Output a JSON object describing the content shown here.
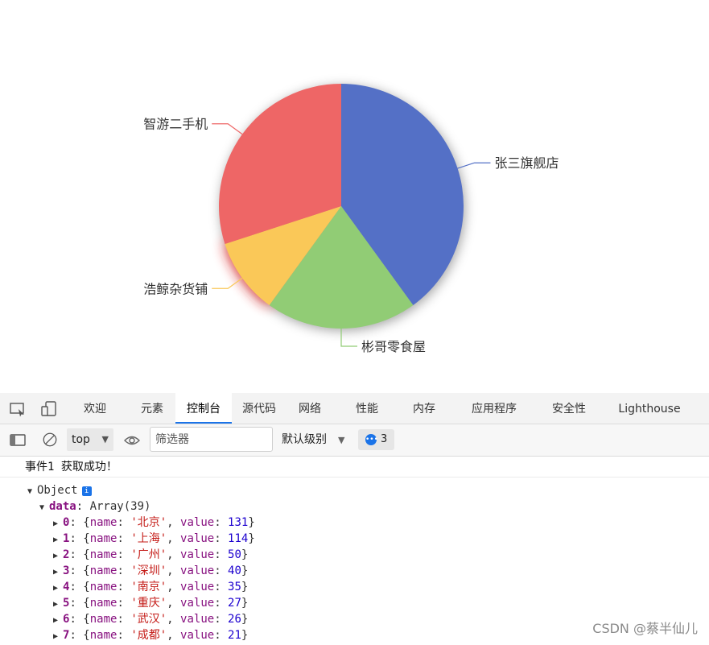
{
  "chart_data": {
    "type": "pie",
    "title": "",
    "slices": [
      {
        "name": "张三旗舰店",
        "value": 40,
        "color": "#5470c6"
      },
      {
        "name": "彬哥零食屋",
        "value": 20,
        "color": "#91cc75"
      },
      {
        "name": "浩鲸杂货铺",
        "value": 10,
        "color": "#fac858"
      },
      {
        "name": "智游二手机",
        "value": 30,
        "color": "#ee6666"
      }
    ],
    "start_angle_deg": 90,
    "direction": "clockwise",
    "labels": "outside-with-leader-lines",
    "emphasis_glow_color": "#ff2020",
    "legend": "none"
  },
  "devtools": {
    "tabs": [
      "欢迎",
      "元素",
      "控制台",
      "源代码",
      "网络",
      "性能",
      "内存",
      "应用程序",
      "安全性",
      "Lighthouse"
    ],
    "active_tab": "控制台",
    "toolbar": {
      "context": "top",
      "filter_placeholder": "筛选器",
      "levels": "默认级别",
      "issues_count": "3"
    },
    "console": {
      "message": "事件1 获取成功！",
      "object_label": "Object",
      "info_badge": "i",
      "data_key": "data",
      "data_summary": "Array(39)",
      "items": [
        {
          "index": "0",
          "name": "北京",
          "value": "131"
        },
        {
          "index": "1",
          "name": "上海",
          "value": "114"
        },
        {
          "index": "2",
          "name": "广州",
          "value": "50"
        },
        {
          "index": "3",
          "name": "深圳",
          "value": "40"
        },
        {
          "index": "4",
          "name": "南京",
          "value": "35"
        },
        {
          "index": "5",
          "name": "重庆",
          "value": "27"
        },
        {
          "index": "6",
          "name": "武汉",
          "value": "26"
        },
        {
          "index": "7",
          "name": "成都",
          "value": "21"
        }
      ]
    }
  },
  "watermark": "CSDN @蔡半仙儿"
}
